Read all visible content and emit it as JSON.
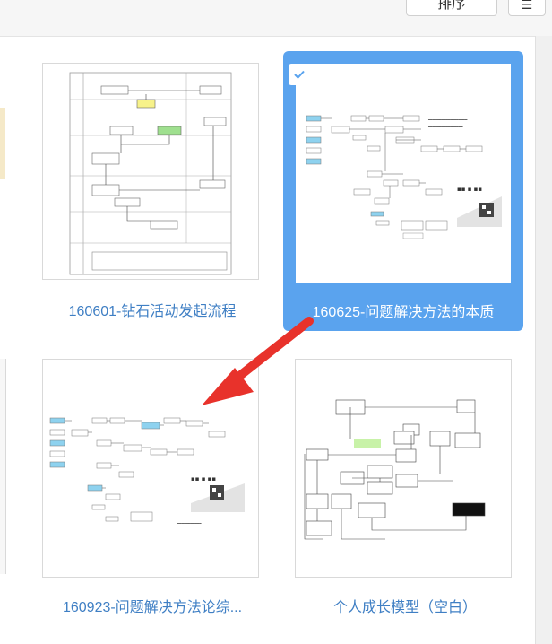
{
  "toolbar": {
    "sort_label": "排序",
    "view_icon": "list-view-icon"
  },
  "files": [
    {
      "name": "160601-钻石活动发起流程",
      "selected": false
    },
    {
      "name": "160625-问题解决方法的本质",
      "selected": true
    },
    {
      "name": "160923-问题解决方法论综...",
      "selected": false
    },
    {
      "name": "个人成长模型（空白）",
      "selected": false
    }
  ],
  "colors": {
    "accent": "#5aa3ee",
    "label": "#3f7fc4",
    "arrow": "#e8322b"
  }
}
